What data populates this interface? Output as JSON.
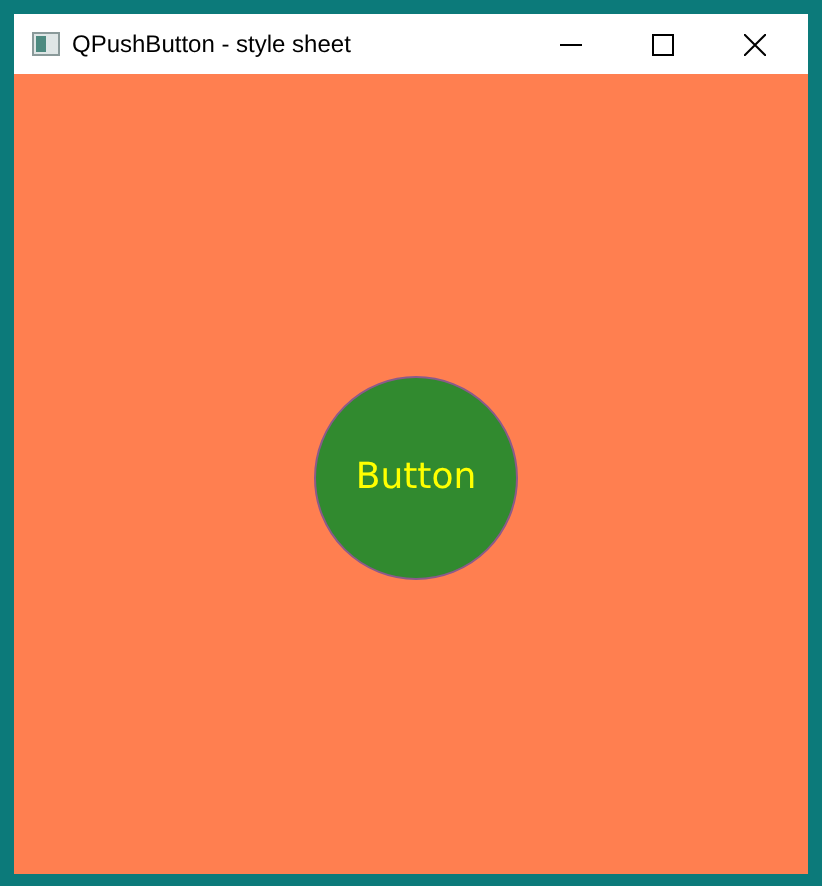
{
  "window": {
    "title": "QPushButton - style sheet"
  },
  "button": {
    "label": "Button"
  }
}
